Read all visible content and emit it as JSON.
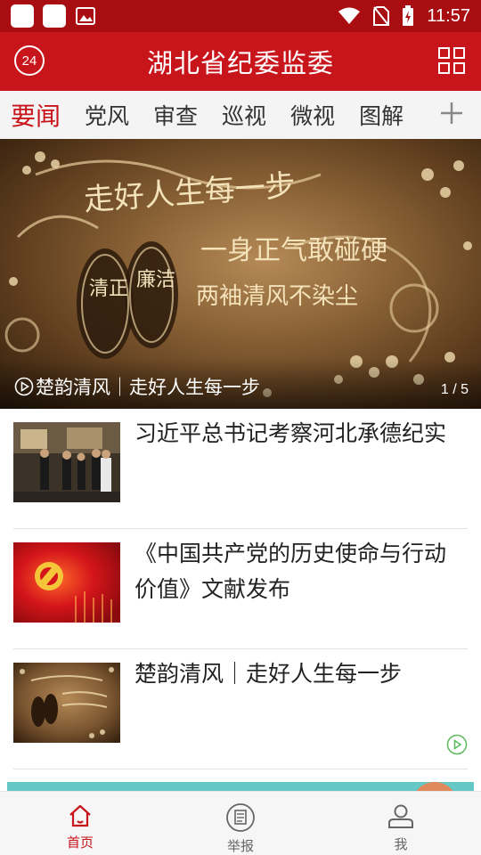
{
  "status_bar": {
    "time": "11:57"
  },
  "header": {
    "title": "湖北省纪委监委",
    "badge": "24"
  },
  "tabs": [
    {
      "label": "要闻"
    },
    {
      "label": "党风"
    },
    {
      "label": "审查"
    },
    {
      "label": "巡视"
    },
    {
      "label": "微视"
    },
    {
      "label": "图解"
    }
  ],
  "banner": {
    "caption": "楚韵清风｜走好人生每一步",
    "pager": "1 / 5",
    "art_text": {
      "line1": "走好人生每一步",
      "line2": "一身正气敢碰硬",
      "line3": "两袖清风不染尘",
      "foot_left": "清正",
      "foot_right": "廉洁"
    }
  },
  "news": [
    {
      "title": "习近平总书记考察河北承德纪实",
      "video": false
    },
    {
      "title": "《中国共产党的历史使命与行动价值》文献发布",
      "video": false
    },
    {
      "title": "楚韵清风｜走好人生每一步",
      "video": true
    }
  ],
  "bottom_nav": [
    {
      "label": "首页",
      "icon": "home-icon",
      "active": true
    },
    {
      "label": "举报",
      "icon": "report-icon",
      "active": false
    },
    {
      "label": "我",
      "icon": "user-icon",
      "active": false
    }
  ],
  "colors": {
    "brand_red": "#c8141b",
    "status_red": "#a80d12",
    "ad_teal": "#66c8c6"
  }
}
